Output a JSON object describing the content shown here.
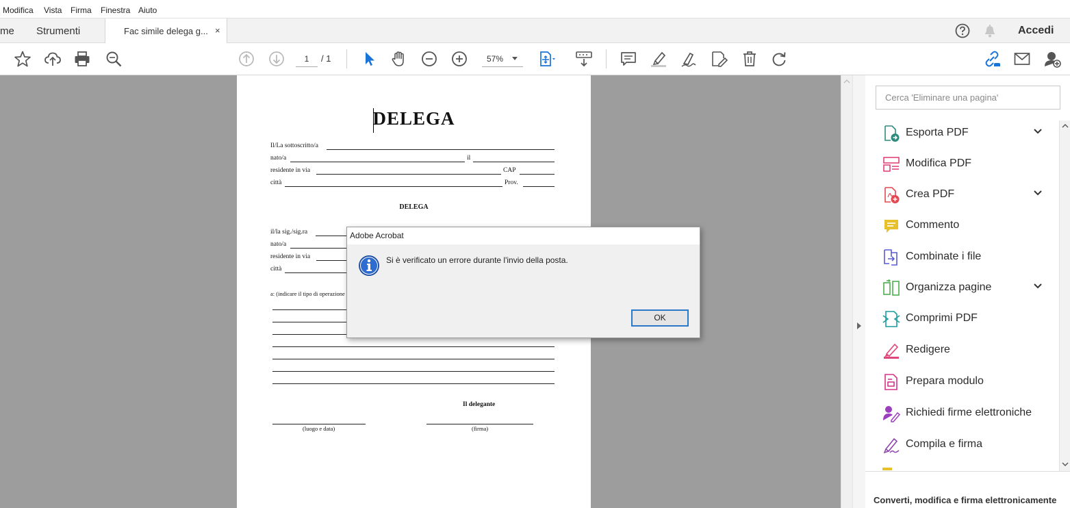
{
  "menubar": {
    "items": [
      "Modifica",
      "Vista",
      "Firma",
      "Finestra",
      "Aiuto"
    ]
  },
  "tabs": {
    "home_partial": "me",
    "tools": "Strumenti",
    "document": "Fac simile delega g...",
    "close_symbol": "×",
    "sign_in": "Accedi"
  },
  "toolbar": {
    "page_current": "1",
    "page_total": "/ 1",
    "zoom": "57%"
  },
  "document": {
    "title": "DELEGA",
    "fields_top": {
      "line1": "Il/La sottoscritto/a",
      "line2_a": "nato/a",
      "line2_b": "il",
      "line3_a": "residente in via",
      "line3_b": "CAP",
      "line4_a": "città",
      "line4_b": "Prov."
    },
    "subtitle": "DELEGA",
    "fields_bottom": {
      "line1": "il/la sig./sig.ra",
      "line2": "nato/a",
      "line3": "residente in via",
      "line4": "città"
    },
    "operation_label": "a:  (indicare il tipo di operazione",
    "delegante": "Il delegante",
    "place_date": "(luogo e data)",
    "signature": "(firma)"
  },
  "right_panel": {
    "search_placeholder": "Cerca 'Eliminare una pagina'",
    "tools": [
      {
        "label": "Esporta PDF",
        "icon": "export-pdf-icon",
        "color": "#2e8b7e",
        "expandable": true
      },
      {
        "label": "Modifica PDF",
        "icon": "edit-pdf-icon",
        "color": "#e0457b",
        "expandable": false
      },
      {
        "label": "Crea PDF",
        "icon": "create-pdf-icon",
        "color": "#e34850",
        "expandable": true
      },
      {
        "label": "Commento",
        "icon": "comment-icon",
        "color": "#e8c02a",
        "expandable": false
      },
      {
        "label": "Combinate i file",
        "icon": "combine-files-icon",
        "color": "#5a5ad6",
        "expandable": false
      },
      {
        "label": "Organizza pagine",
        "icon": "organize-pages-icon",
        "color": "#4caf50",
        "expandable": true
      },
      {
        "label": "Comprimi PDF",
        "icon": "compress-pdf-icon",
        "color": "#1a9c9c",
        "expandable": false
      },
      {
        "label": "Redigere",
        "icon": "redact-icon",
        "color": "#e0457b",
        "expandable": false
      },
      {
        "label": "Prepara modulo",
        "icon": "prepare-form-icon",
        "color": "#d6338a",
        "expandable": false
      },
      {
        "label": "Richiedi firme elettroniche",
        "icon": "request-signatures-icon",
        "color": "#9b3fbf",
        "expandable": false
      },
      {
        "label": "Compila e firma",
        "icon": "fill-sign-icon",
        "color": "#8e44ad",
        "expandable": false
      }
    ],
    "promo": "Converti, modifica e firma elettronicamente"
  },
  "dialog": {
    "title": "Adobe Acrobat",
    "message": "Si è verificato un errore durante l'invio della posta.",
    "ok": "OK"
  }
}
